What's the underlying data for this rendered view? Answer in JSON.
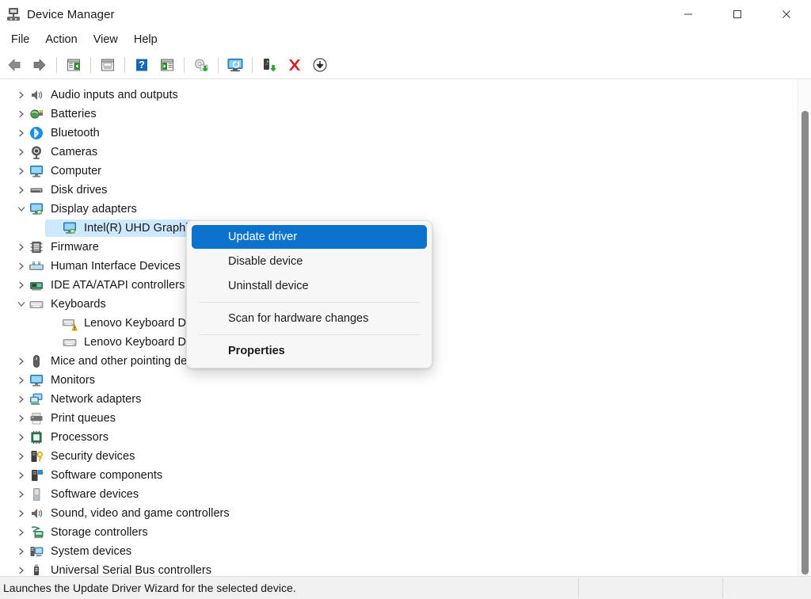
{
  "window": {
    "title": "Device Manager",
    "app_icon": "device-manager-icon",
    "controls": {
      "minimize": "minimize-icon",
      "maximize": "maximize-icon",
      "close": "close-icon"
    }
  },
  "menubar": {
    "items": [
      {
        "label": "File"
      },
      {
        "label": "Action"
      },
      {
        "label": "View"
      },
      {
        "label": "Help"
      }
    ]
  },
  "toolbar": {
    "buttons": [
      {
        "name": "back-arrow-icon",
        "tooltip": "Back"
      },
      {
        "name": "forward-arrow-icon",
        "tooltip": "Forward"
      },
      {
        "name": "show-hide-console-tree-icon",
        "tooltip": "Show/Hide Console Tree"
      },
      {
        "name": "properties-icon",
        "tooltip": "Properties"
      },
      {
        "name": "help-icon",
        "tooltip": "Help"
      },
      {
        "name": "show-hide-action-pane-icon",
        "tooltip": "Show/Hide Action Pane"
      },
      {
        "name": "update-driver-icon",
        "tooltip": "Update Driver Software"
      },
      {
        "name": "scan-for-hardware-changes-icon",
        "tooltip": "Scan for hardware changes"
      },
      {
        "name": "enable-device-icon",
        "tooltip": "Enable device"
      },
      {
        "name": "uninstall-device-icon",
        "tooltip": "Uninstall device"
      },
      {
        "name": "disable-device-icon",
        "tooltip": "Disable device"
      }
    ]
  },
  "tree": {
    "items": [
      {
        "label": "Audio inputs and outputs",
        "level": 0,
        "expander": "collapsed",
        "icon": "speaker-icon"
      },
      {
        "label": "Batteries",
        "level": 0,
        "expander": "collapsed",
        "icon": "battery-icon"
      },
      {
        "label": "Bluetooth",
        "level": 0,
        "expander": "collapsed",
        "icon": "bluetooth-icon"
      },
      {
        "label": "Cameras",
        "level": 0,
        "expander": "collapsed",
        "icon": "camera-icon"
      },
      {
        "label": "Computer",
        "level": 0,
        "expander": "collapsed",
        "icon": "computer-icon"
      },
      {
        "label": "Disk drives",
        "level": 0,
        "expander": "collapsed",
        "icon": "disk-drive-icon"
      },
      {
        "label": "Display adapters",
        "level": 0,
        "expander": "expanded",
        "icon": "display-adapter-icon"
      },
      {
        "label": "Intel(R) UHD Graphics",
        "level": 1,
        "expander": "none",
        "icon": "display-adapter-icon",
        "selected": true
      },
      {
        "label": "Firmware",
        "level": 0,
        "expander": "collapsed",
        "icon": "firmware-icon"
      },
      {
        "label": "Human Interface Devices",
        "level": 0,
        "expander": "collapsed",
        "icon": "hid-icon"
      },
      {
        "label": "IDE ATA/ATAPI controllers",
        "level": 0,
        "expander": "collapsed",
        "icon": "ide-controller-icon"
      },
      {
        "label": "Keyboards",
        "level": 0,
        "expander": "expanded",
        "icon": "keyboard-icon"
      },
      {
        "label": "Lenovo Keyboard Device",
        "level": 1,
        "expander": "none",
        "icon": "keyboard-warning-icon"
      },
      {
        "label": "Lenovo Keyboard Device",
        "level": 1,
        "expander": "none",
        "icon": "keyboard-icon"
      },
      {
        "label": "Mice and other pointing devices",
        "level": 0,
        "expander": "collapsed",
        "icon": "mouse-icon"
      },
      {
        "label": "Monitors",
        "level": 0,
        "expander": "collapsed",
        "icon": "monitor-icon"
      },
      {
        "label": "Network adapters",
        "level": 0,
        "expander": "collapsed",
        "icon": "network-adapter-icon"
      },
      {
        "label": "Print queues",
        "level": 0,
        "expander": "collapsed",
        "icon": "printer-icon"
      },
      {
        "label": "Processors",
        "level": 0,
        "expander": "collapsed",
        "icon": "processor-icon"
      },
      {
        "label": "Security devices",
        "level": 0,
        "expander": "collapsed",
        "icon": "security-device-icon"
      },
      {
        "label": "Software components",
        "level": 0,
        "expander": "collapsed",
        "icon": "software-component-icon"
      },
      {
        "label": "Software devices",
        "level": 0,
        "expander": "collapsed",
        "icon": "software-device-icon"
      },
      {
        "label": "Sound, video and game controllers",
        "level": 0,
        "expander": "collapsed",
        "icon": "speaker-icon"
      },
      {
        "label": "Storage controllers",
        "level": 0,
        "expander": "collapsed",
        "icon": "storage-controller-icon"
      },
      {
        "label": "System devices",
        "level": 0,
        "expander": "collapsed",
        "icon": "system-device-icon"
      },
      {
        "label": "Universal Serial Bus controllers",
        "level": 0,
        "expander": "collapsed",
        "icon": "usb-icon"
      }
    ]
  },
  "context_menu": {
    "items": [
      {
        "label": "Update driver",
        "highlighted": true,
        "bold": false,
        "separator_before": false
      },
      {
        "label": "Disable device",
        "highlighted": false,
        "bold": false,
        "separator_before": false
      },
      {
        "label": "Uninstall device",
        "highlighted": false,
        "bold": false,
        "separator_before": false
      },
      {
        "label": "Scan for hardware changes",
        "highlighted": false,
        "bold": false,
        "separator_before": true
      },
      {
        "label": "Properties",
        "highlighted": false,
        "bold": true,
        "separator_before": true
      }
    ]
  },
  "statusbar": {
    "text": "Launches the Update Driver Wizard for the selected device."
  },
  "colors": {
    "menu_highlight": "#0c73cc",
    "tree_selection": "#cde8ff",
    "titlebar_bg": "#ffffff",
    "statusbar_bg": "#f0f0f0",
    "scrollbar_thumb": "#8a8a8a"
  }
}
